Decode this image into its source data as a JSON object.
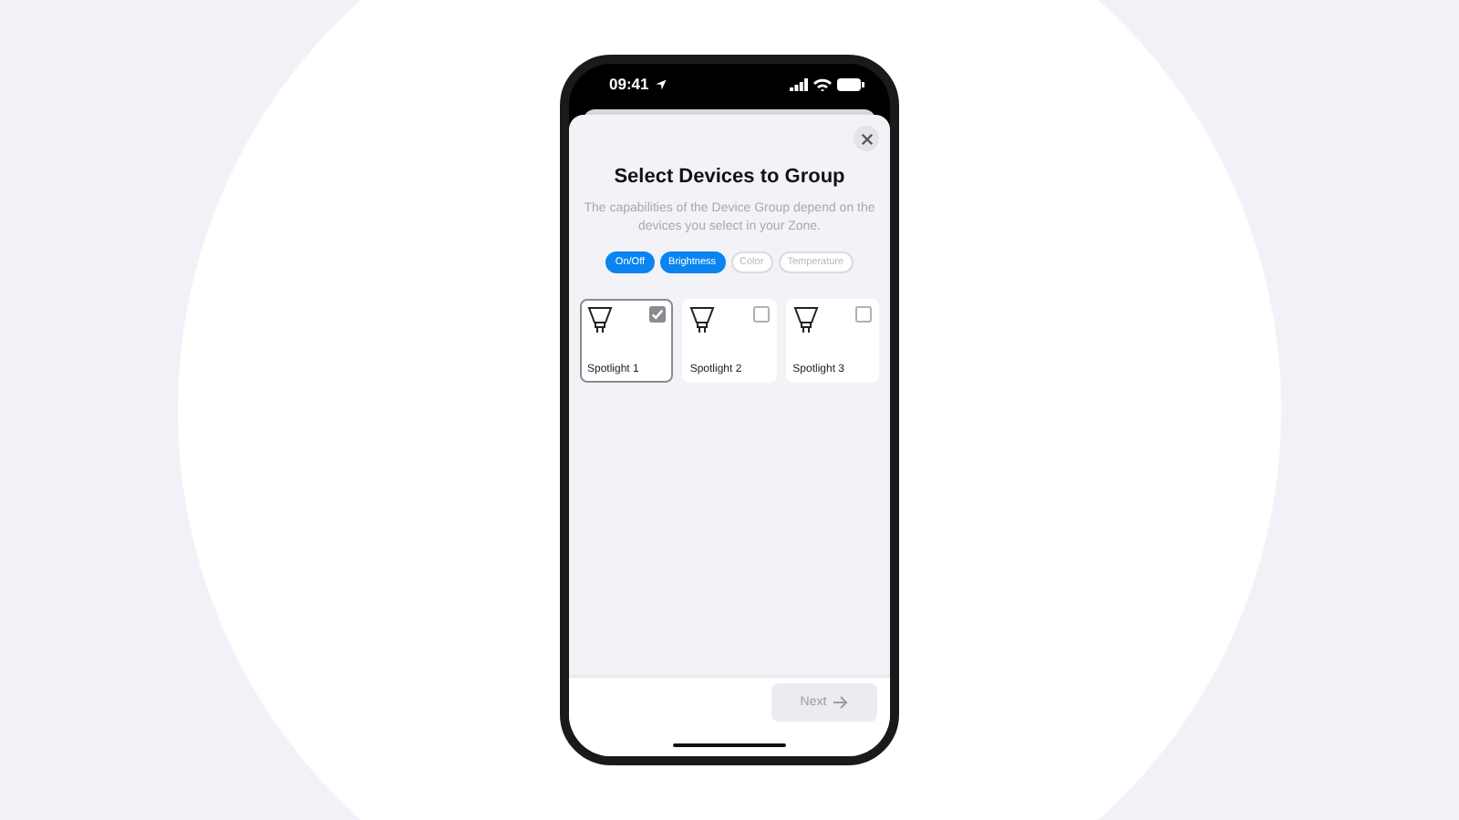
{
  "status_bar": {
    "time": "09:41"
  },
  "sheet": {
    "title": "Select Devices to Group",
    "description": "The capabilities of the Device Group depend on the devices you select in your Zone.",
    "capabilities": [
      {
        "label": "On/Off",
        "on": true
      },
      {
        "label": "Brightness",
        "on": true
      },
      {
        "label": "Color",
        "on": false
      },
      {
        "label": "Temperature",
        "on": false
      }
    ],
    "devices": [
      {
        "name": "Spotlight 1",
        "selected": true
      },
      {
        "name": "Spotlight 2",
        "selected": false
      },
      {
        "name": "Spotlight 3",
        "selected": false
      }
    ]
  },
  "footer": {
    "next_button": {
      "label": "Next",
      "disabled": true
    }
  }
}
